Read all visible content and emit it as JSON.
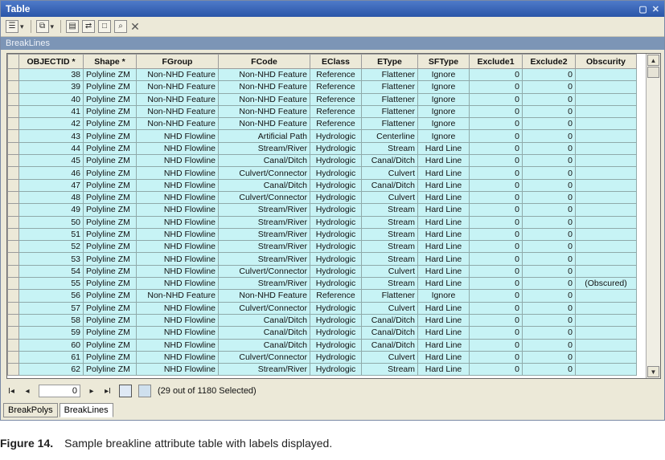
{
  "window": {
    "title": "Table"
  },
  "layer_strip": "BreakLines",
  "columns": [
    "",
    "OBJECTID *",
    "Shape *",
    "FGroup",
    "FCode",
    "EClass",
    "EType",
    "SFType",
    "Exclude1",
    "Exclude2",
    "Obscurity"
  ],
  "rows": [
    [
      "38",
      "Polyline ZM",
      "Non-NHD Feature",
      "Non-NHD Feature",
      "Reference",
      "Flattener",
      "Ignore",
      "0",
      "0",
      ""
    ],
    [
      "39",
      "Polyline ZM",
      "Non-NHD Feature",
      "Non-NHD Feature",
      "Reference",
      "Flattener",
      "Ignore",
      "0",
      "0",
      ""
    ],
    [
      "40",
      "Polyline ZM",
      "Non-NHD Feature",
      "Non-NHD Feature",
      "Reference",
      "Flattener",
      "Ignore",
      "0",
      "0",
      ""
    ],
    [
      "41",
      "Polyline ZM",
      "Non-NHD Feature",
      "Non-NHD Feature",
      "Reference",
      "Flattener",
      "Ignore",
      "0",
      "0",
      ""
    ],
    [
      "42",
      "Polyline ZM",
      "Non-NHD Feature",
      "Non-NHD Feature",
      "Reference",
      "Flattener",
      "Ignore",
      "0",
      "0",
      ""
    ],
    [
      "43",
      "Polyline ZM",
      "NHD Flowline",
      "Artificial Path",
      "Hydrologic",
      "Centerline",
      "Ignore",
      "0",
      "0",
      ""
    ],
    [
      "44",
      "Polyline ZM",
      "NHD Flowline",
      "Stream/River",
      "Hydrologic",
      "Stream",
      "Hard Line",
      "0",
      "0",
      ""
    ],
    [
      "45",
      "Polyline ZM",
      "NHD Flowline",
      "Canal/Ditch",
      "Hydrologic",
      "Canal/Ditch",
      "Hard Line",
      "0",
      "0",
      ""
    ],
    [
      "46",
      "Polyline ZM",
      "NHD Flowline",
      "Culvert/Connector",
      "Hydrologic",
      "Culvert",
      "Hard Line",
      "0",
      "0",
      ""
    ],
    [
      "47",
      "Polyline ZM",
      "NHD Flowline",
      "Canal/Ditch",
      "Hydrologic",
      "Canal/Ditch",
      "Hard Line",
      "0",
      "0",
      ""
    ],
    [
      "48",
      "Polyline ZM",
      "NHD Flowline",
      "Culvert/Connector",
      "Hydrologic",
      "Culvert",
      "Hard Line",
      "0",
      "0",
      ""
    ],
    [
      "49",
      "Polyline ZM",
      "NHD Flowline",
      "Stream/River",
      "Hydrologic",
      "Stream",
      "Hard Line",
      "0",
      "0",
      ""
    ],
    [
      "50",
      "Polyline ZM",
      "NHD Flowline",
      "Stream/River",
      "Hydrologic",
      "Stream",
      "Hard Line",
      "0",
      "0",
      ""
    ],
    [
      "51",
      "Polyline ZM",
      "NHD Flowline",
      "Stream/River",
      "Hydrologic",
      "Stream",
      "Hard Line",
      "0",
      "0",
      ""
    ],
    [
      "52",
      "Polyline ZM",
      "NHD Flowline",
      "Stream/River",
      "Hydrologic",
      "Stream",
      "Hard Line",
      "0",
      "0",
      ""
    ],
    [
      "53",
      "Polyline ZM",
      "NHD Flowline",
      "Stream/River",
      "Hydrologic",
      "Stream",
      "Hard Line",
      "0",
      "0",
      ""
    ],
    [
      "54",
      "Polyline ZM",
      "NHD Flowline",
      "Culvert/Connector",
      "Hydrologic",
      "Culvert",
      "Hard Line",
      "0",
      "0",
      ""
    ],
    [
      "55",
      "Polyline ZM",
      "NHD Flowline",
      "Stream/River",
      "Hydrologic",
      "Stream",
      "Hard Line",
      "0",
      "0",
      "(Obscured)"
    ],
    [
      "56",
      "Polyline ZM",
      "Non-NHD Feature",
      "Non-NHD Feature",
      "Reference",
      "Flattener",
      "Ignore",
      "0",
      "0",
      ""
    ],
    [
      "57",
      "Polyline ZM",
      "NHD Flowline",
      "Culvert/Connector",
      "Hydrologic",
      "Culvert",
      "Hard Line",
      "0",
      "0",
      ""
    ],
    [
      "58",
      "Polyline ZM",
      "NHD Flowline",
      "Canal/Ditch",
      "Hydrologic",
      "Canal/Ditch",
      "Hard Line",
      "0",
      "0",
      ""
    ],
    [
      "59",
      "Polyline ZM",
      "NHD Flowline",
      "Canal/Ditch",
      "Hydrologic",
      "Canal/Ditch",
      "Hard Line",
      "0",
      "0",
      ""
    ],
    [
      "60",
      "Polyline ZM",
      "NHD Flowline",
      "Canal/Ditch",
      "Hydrologic",
      "Canal/Ditch",
      "Hard Line",
      "0",
      "0",
      ""
    ],
    [
      "61",
      "Polyline ZM",
      "NHD Flowline",
      "Culvert/Connector",
      "Hydrologic",
      "Culvert",
      "Hard Line",
      "0",
      "0",
      ""
    ],
    [
      "62",
      "Polyline ZM",
      "NHD Flowline",
      "Stream/River",
      "Hydrologic",
      "Stream",
      "Hard Line",
      "0",
      "0",
      ""
    ]
  ],
  "nav": {
    "record": "0",
    "selection": "(29 out of 1180 Selected)"
  },
  "tabs": [
    "BreakPolys",
    "BreakLines"
  ],
  "caption": {
    "label": "Figure 14.",
    "text": "Sample breakline attribute table with labels displayed."
  },
  "colors": {
    "selected_row": "#c7f3f5",
    "titlebar": "#2a55a8",
    "frame": "#ece9d8"
  }
}
